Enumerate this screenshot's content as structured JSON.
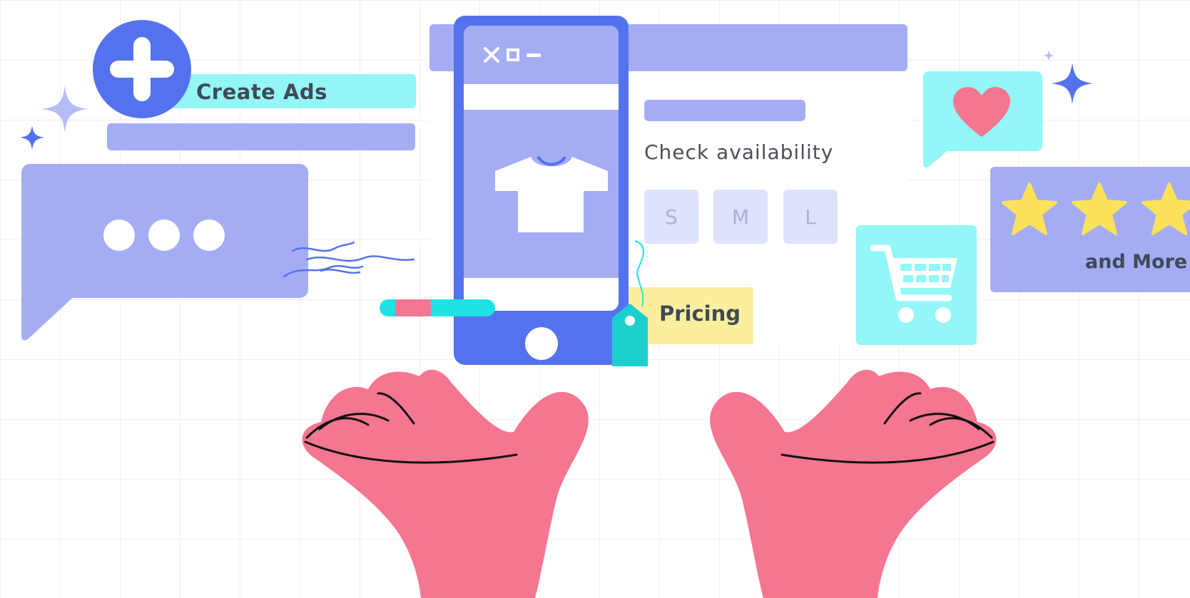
{
  "create_ads": {
    "label": "Create Ads"
  },
  "product": {
    "check_label": "Check availability",
    "sizes": [
      "S",
      "M",
      "L"
    ]
  },
  "pricing": {
    "label": "Pricing"
  },
  "reviews": {
    "label": "and More"
  },
  "colors": {
    "blue": "#5572ee",
    "periwinkle": "#a4adf4",
    "cyan": "#93f6f7",
    "pink": "#f57691",
    "yellow": "#fbee9f",
    "star": "#fbe25a"
  }
}
